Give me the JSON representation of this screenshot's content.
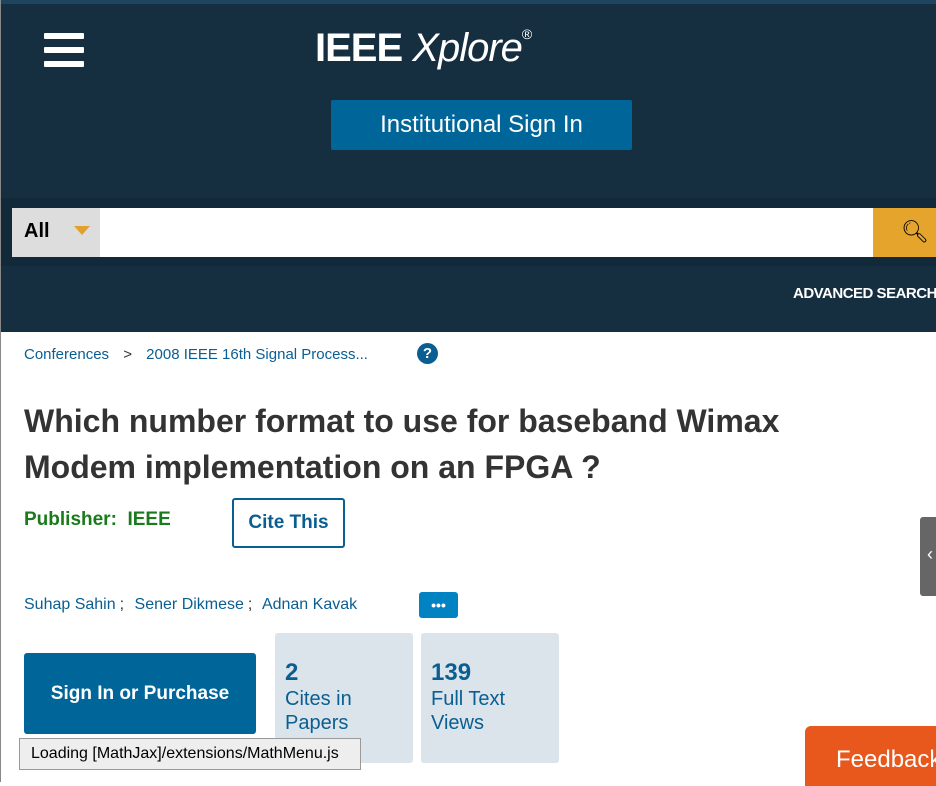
{
  "header": {
    "logo_main": "IEEE",
    "logo_script": "Xplore",
    "logo_reg": "®",
    "institutional_sign_in": "Institutional Sign In"
  },
  "search": {
    "scope": "All",
    "placeholder": "",
    "advanced": "ADVANCED SEARCH"
  },
  "breadcrumb": [
    "Conferences",
    ">",
    "2008 IEEE 16th Signal Process..."
  ],
  "article": {
    "title": "Which number format to use for baseband Wimax Modem implementation on an FPGA ?",
    "publisher_label": "Publisher:",
    "publisher": "IEEE",
    "cite_this": "Cite This",
    "authors": [
      "Suhap Sahin",
      "Sener Dikmese",
      "Adnan Kavak"
    ],
    "separator": ";"
  },
  "actions": {
    "sign_in_purchase": "Sign In or Purchase"
  },
  "metrics": [
    {
      "value": "2",
      "label": "Cites in Papers"
    },
    {
      "value": "139",
      "label": "Full Text Views"
    }
  ],
  "status": {
    "loading": "Loading [MathJax]/extensions/MathMenu.js"
  },
  "feedback": "Feedback",
  "colors": {
    "header": "#162f40",
    "accent": "#e5a42b",
    "primary": "#006699",
    "feedback": "#e8581d"
  }
}
